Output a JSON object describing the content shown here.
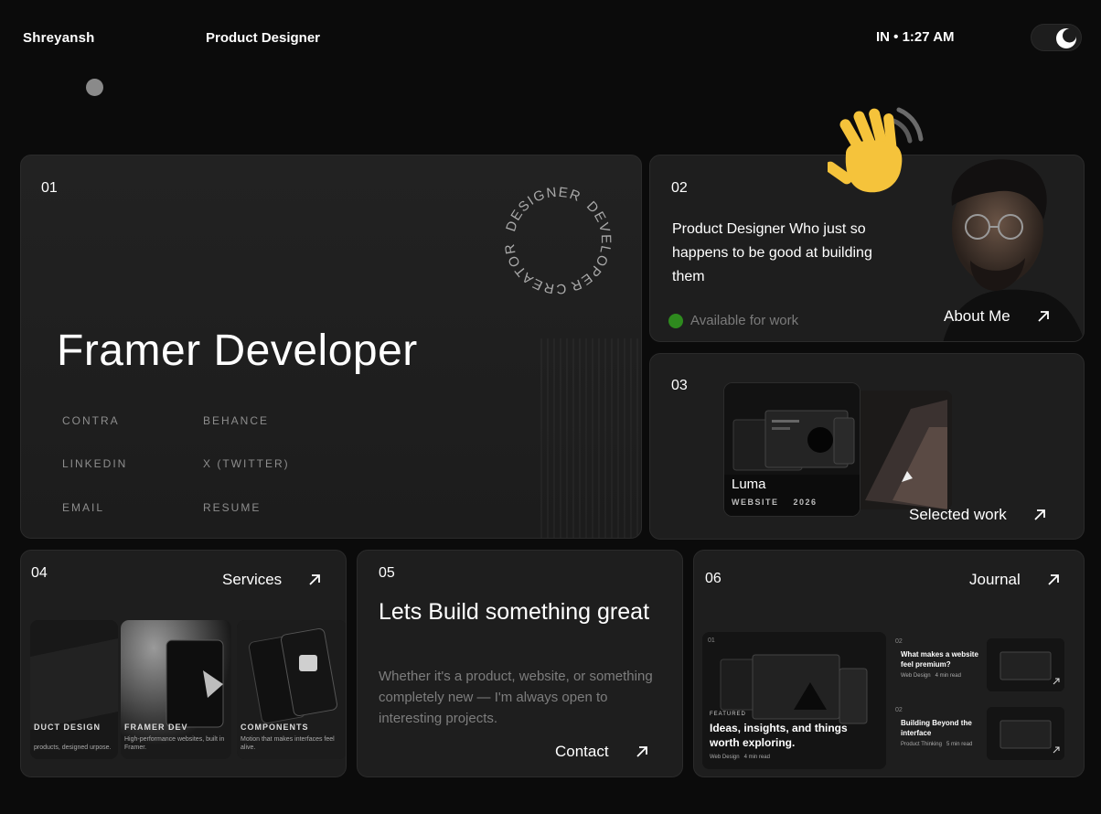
{
  "header": {
    "name": "Shreyansh",
    "role": "Product Designer",
    "time": "IN • 1:27 AM",
    "theme_toggle_icon": "moon-icon"
  },
  "hero": {
    "number": "01",
    "headline": "Framer Developer",
    "ring_words": [
      "DESIGNER",
      "DEVELOPER",
      "CREATOR"
    ],
    "links": [
      "CONTRA",
      "BEHANCE",
      "LINKEDIN",
      "X (TWITTER)",
      "EMAIL",
      "RESUME"
    ]
  },
  "about": {
    "number": "02",
    "bio": "Product Designer Who just so happens to be good at building them",
    "availability": "Available for work",
    "availability_color": "#2e8a1e",
    "cta": "About Me"
  },
  "work": {
    "number": "03",
    "project_title": "Luma",
    "project_type": "WEBSITE",
    "project_year": "2026",
    "cta": "Selected work"
  },
  "services": {
    "number": "04",
    "cta": "Services",
    "items": [
      {
        "title": "DUCT DESIGN",
        "desc": "products, designed urpose."
      },
      {
        "title": "FRAMER DEV",
        "desc": "High-performance websites, built in Framer."
      },
      {
        "title": "COMPONENTS",
        "desc": "Motion that makes interfaces feel alive."
      }
    ]
  },
  "contact": {
    "number": "05",
    "headline": "Lets Build something great",
    "body": "Whether it's a product, website, or something completely new — I'm always open to interesting projects.",
    "cta": "Contact"
  },
  "journal": {
    "number": "06",
    "cta": "Journal",
    "featured": {
      "number": "01",
      "label": "FEATURED",
      "title": "Ideas, insights, and things worth exploring.",
      "category": "Web Design",
      "read_time": "4 min read"
    },
    "posts": [
      {
        "number": "02",
        "title": "What makes a website feel premium?",
        "category": "Web Design",
        "read_time": "4 min read"
      },
      {
        "number": "02",
        "title": "Building Beyond the interface",
        "category": "Product Thinking",
        "read_time": "5 min read"
      }
    ]
  }
}
